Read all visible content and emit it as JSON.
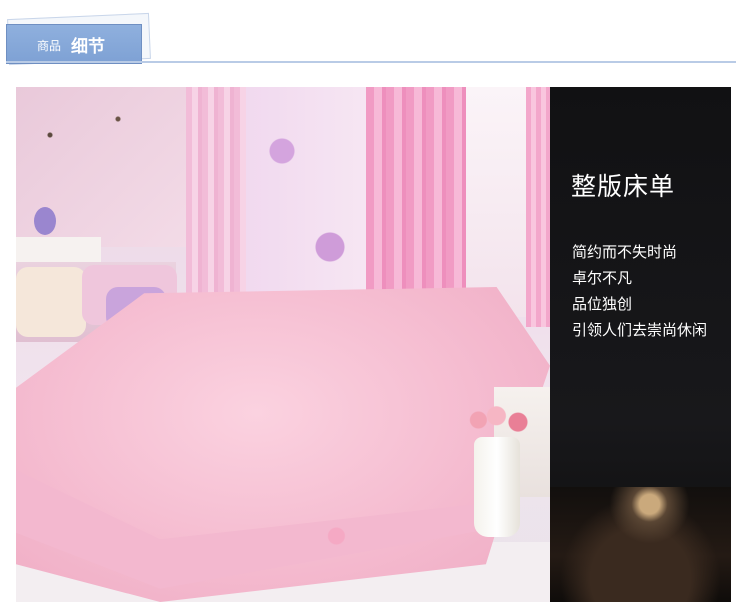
{
  "header": {
    "tab_small": "商品",
    "tab_big": "细节"
  },
  "photo": {
    "panel_title": "整版床单",
    "lines": [
      "简约而不失时尚",
      "卓尔不凡",
      "品位独创",
      "引领人们去崇尚休闲"
    ]
  },
  "colors": {
    "tab_blue": "#7ea1d4",
    "panel_dark": "#15151a",
    "sheet_pink": "#f4b9ce"
  }
}
